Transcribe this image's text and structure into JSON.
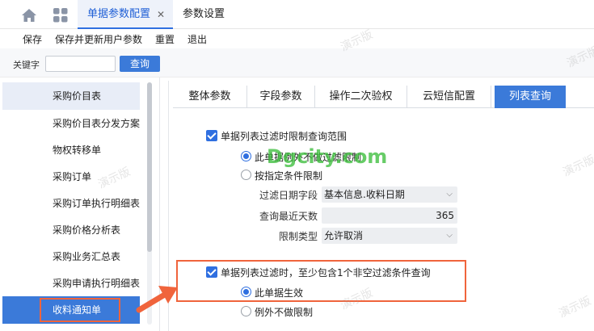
{
  "top_tabs": [
    {
      "label": "单据参数配置"
    },
    {
      "label": "参数设置"
    }
  ],
  "toolbar": [
    "保存",
    "保存并更新用户参数",
    "重置",
    "退出"
  ],
  "search": {
    "label": "关键字",
    "value": "",
    "button": "查询"
  },
  "left_list": [
    "采购价目表",
    "采购价目表分发方案",
    "物权转移单",
    "采购订单",
    "采购订单执行明细表",
    "采购价格分析表",
    "采购业务汇总表",
    "采购申请执行明细表",
    "收料通知单"
  ],
  "sub_tabs": [
    "整体参数",
    "字段参数",
    "操作二次验权",
    "云短信配置",
    "列表查询"
  ],
  "section1": {
    "checkbox_label": "单据列表过滤时限制查询范围",
    "radio1": "此单据例外不做过滤限制",
    "radio2": "按指定条件限制",
    "filter_date_label": "过滤日期字段",
    "filter_date_value": "基本信息.收料日期",
    "recent_days_label": "查询最近天数",
    "recent_days_value": "365",
    "limit_type_label": "限制类型",
    "limit_type_value": "允许取消"
  },
  "section2": {
    "checkbox_label": "单据列表过滤时，至少包含1个非空过滤条件查询",
    "radio1": "此单据生效",
    "radio2": "例外不做限制"
  },
  "watermark_text": "演示版",
  "site_watermark": "Dgcity.com",
  "colors": {
    "accent": "#3b7ad9",
    "highlight": "#f0643c"
  }
}
